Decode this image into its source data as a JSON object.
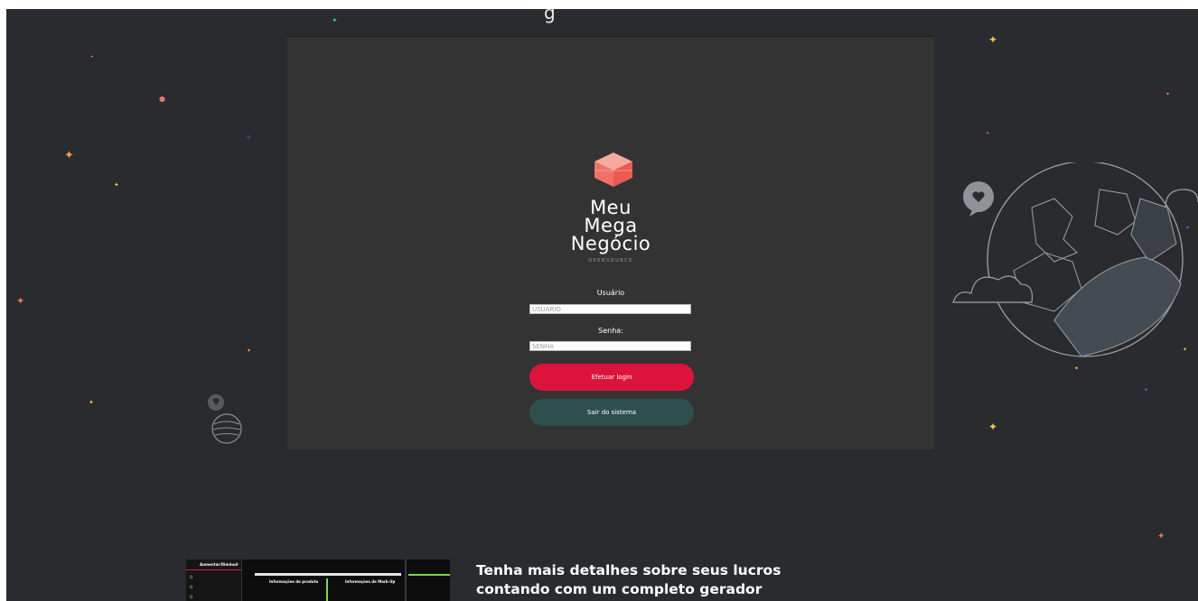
{
  "page": {
    "top_title": "g"
  },
  "brand": {
    "line1": "Meu",
    "line2": "Mega",
    "line3": "Negócio",
    "subtitle": "OPENSOURCE",
    "cube_color": "#f07167"
  },
  "login": {
    "user_label": "Usuário",
    "user_placeholder": "USUÁRIO",
    "password_label": "Senha:",
    "password_placeholder": "SENHA",
    "login_button": "Efetuar login",
    "exit_button": "Sair do sistema"
  },
  "promo": {
    "headline_line1": "Tenha mais detalhes sobre seus lucros",
    "headline_line2": "contando com um completo gerador",
    "preview": {
      "sidebar_title": "Aumentar/Diminuir",
      "menu_items": [
        "Q",
        "Q",
        "Q"
      ],
      "section_product": "Informações do produto",
      "section_markup": "Informações de Mark-Up"
    }
  },
  "colors": {
    "background": "#2a2b2f",
    "panel": "#333333",
    "primary": "#dc143c",
    "secondary": "#2f4f4f"
  }
}
